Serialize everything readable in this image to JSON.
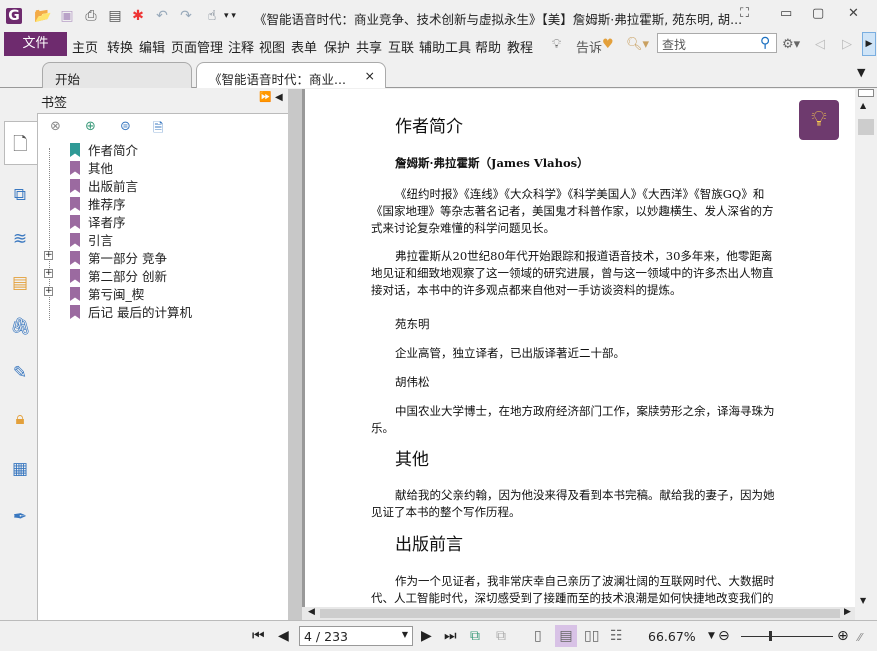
{
  "window": {
    "title": "《智能语音时代：商业竞争、技术创新与虚拟永生》【美】詹姆斯·弗拉霍斯, 苑东明, 胡..."
  },
  "menu": {
    "file": "文件",
    "items": [
      "主页",
      "转换",
      "编辑",
      "页面管理",
      "注释",
      "视图",
      "表单",
      "保护",
      "共享",
      "互联",
      "辅助工具",
      "帮助",
      "教程"
    ],
    "tell": "告诉",
    "search_placeholder": "查找"
  },
  "tabs": [
    {
      "label": "开始"
    },
    {
      "label": "《智能语音时代：商业..."
    }
  ],
  "tab_close": "×",
  "bookmarks": {
    "title": "书签",
    "items": [
      {
        "label": "作者简介",
        "expandable": false,
        "active": true
      },
      {
        "label": "其他",
        "expandable": false
      },
      {
        "label": "出版前言",
        "expandable": false
      },
      {
        "label": "推荐序",
        "expandable": false
      },
      {
        "label": "译者序",
        "expandable": false
      },
      {
        "label": "引言",
        "expandable": false
      },
      {
        "label": "第一部分 竞争",
        "expandable": true
      },
      {
        "label": "第二部分 创新",
        "expandable": true
      },
      {
        "label": "第亏闽_楔",
        "expandable": true
      },
      {
        "label": "后记 最后的计算机",
        "expandable": false
      }
    ]
  },
  "document": {
    "h1": "作者简介",
    "author": "詹姆斯·弗拉霍斯（James Vlahos）",
    "p1": "《纽约时报》《连线》《大众科学》《科学美国人》《大西洋》《智族GQ》和《国家地理》等杂志著名记者，美国鬼才科普作家，以妙趣横生、发人深省的方式来讨论复杂难懂的科学问题见长。",
    "p2": "弗拉霍斯从20世纪80年代开始跟踪和报道语音技术，30多年来，他零距离地见证和细致地观察了这一领域的研究进展，曾与这一领域中的许多杰出人物直接对话，本书中的许多观点都来自他对一手访谈资料的提炼。",
    "t1": "苑东明",
    "t1desc": "企业高管，独立译者，已出版译著近二十部。",
    "t2": "胡伟松",
    "t2desc": "中国农业大学博士，在地方政府经济部门工作，案牍劳形之余，译海寻珠为乐。",
    "h2": "其他",
    "p3": "献给我的父亲约翰，因为他没来得及看到本书完稿。献给我的妻子，因为她见证了本书的整个写作历程。",
    "h3": "出版前言",
    "p4": "作为一个见证者，我非常庆幸自己亲历了波澜壮阔的互联网时代、大数据时代、人工智能时代，深切感受到了接踵而至的技术浪潮是如何快捷地改变我们的"
  },
  "status": {
    "page": "4 / 233",
    "zoom": "66.67%",
    "zoom_fraction": 0.6667
  },
  "colors": {
    "accent": "#6e2b6e",
    "bookmark": "#9b6aa0",
    "active_bookmark": "#2f9a96"
  }
}
